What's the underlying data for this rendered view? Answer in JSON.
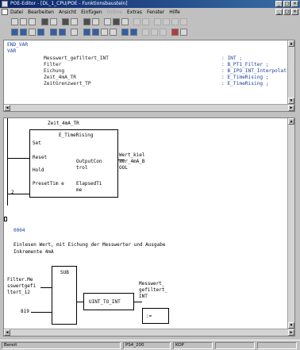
{
  "window": {
    "title": "POE-Editor - [DL_1_CPU/POE - Funktionsbaustein]"
  },
  "menu": [
    {
      "label": "Datei",
      "enabled": true
    },
    {
      "label": "Bearbeiten",
      "enabled": true
    },
    {
      "label": "Ansicht",
      "enabled": true
    },
    {
      "label": "Einfügen",
      "enabled": true
    },
    {
      "label": "Online",
      "enabled": false
    },
    {
      "label": "Extras",
      "enabled": true
    },
    {
      "label": "Fenster",
      "enabled": true
    },
    {
      "label": "Hilfe",
      "enabled": true
    }
  ],
  "declaration": {
    "end_var": "END_VAR",
    "var": "VAR",
    "rows": [
      {
        "name": "Messwert_gefiltert_INT",
        "type": ": INT ;"
      },
      {
        "name": "Filter",
        "type": ": B_PT1_Filter ;"
      },
      {
        "name": "Eichung",
        "type": ": B_IPO_INT_Interpolation ;"
      },
      {
        "name": "Zeit_4mA_TR",
        "type": ": E_TimeRising ;"
      },
      {
        "name": "ZeitGrenzwert_TP",
        "type": ": E_TimeRising ;"
      }
    ]
  },
  "body": {
    "instance_name": "Zeit_4mA_TR",
    "block_type": "E_TimeRising",
    "inputs": [
      "Set",
      "Reset",
      "Hold",
      "PresetTim e"
    ],
    "outputs": [
      "OutputCon trol",
      "ElapsedTi me"
    ],
    "output_var": "Wert_kiel\naer_4mA_B\nOOL",
    "rung_number": "2",
    "network_number": "0004",
    "comment": "Einlesen Wert, mit Eichung der Messwerter und Ausgabe\nInkremente 4mA",
    "filter_var": "Filter.Me\nsswertgefi\nltert_12",
    "sub_block": "SUB",
    "const_input": "819",
    "conv_block": "UINT_TO_INT",
    "assign_block": ":=",
    "result_var": "Messwert_\ngefiltert_\nINT"
  },
  "status": {
    "mode": "Bereit",
    "plc": "PS4_200",
    "lang": "KOP"
  }
}
